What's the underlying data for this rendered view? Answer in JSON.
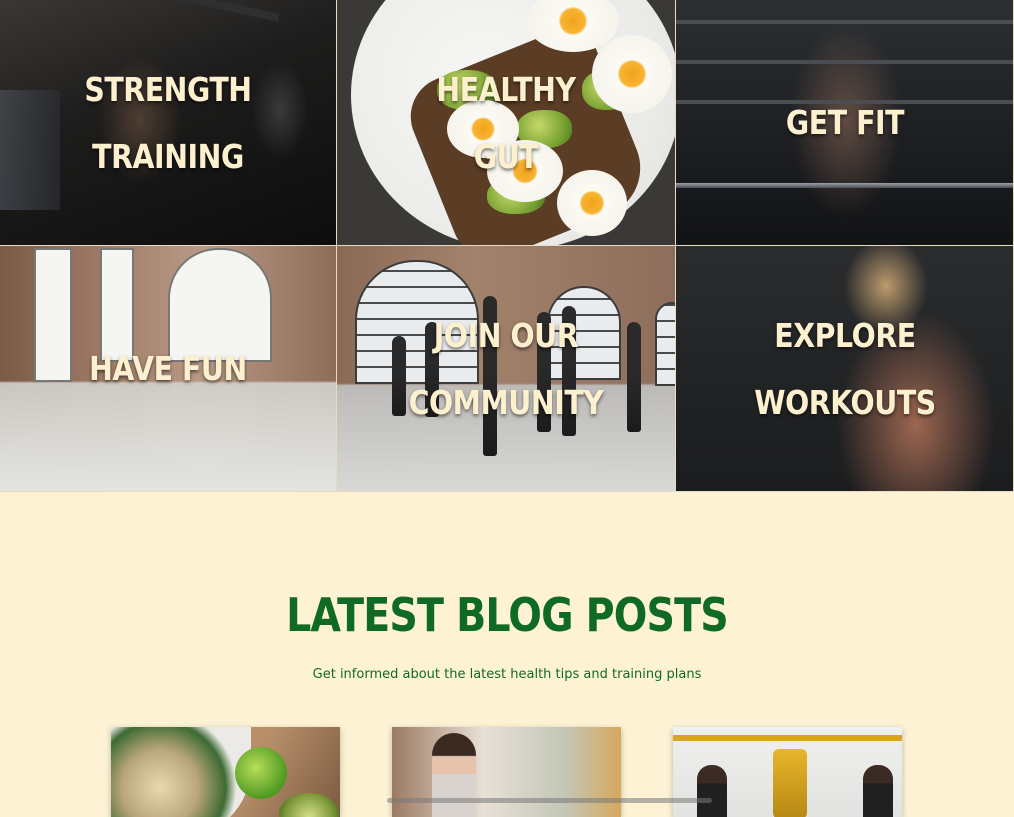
{
  "tiles": [
    {
      "label": "STRENGTH TRAINING",
      "image": "strength-training-photo"
    },
    {
      "label": "HEALTHY GUT",
      "image": "healthy-gut-photo"
    },
    {
      "label": "GET FIT",
      "image": "get-fit-photo"
    },
    {
      "label": "HAVE FUN",
      "image": "have-fun-photo"
    },
    {
      "label": "JOIN OUR COMMUNITY",
      "image": "join-our-community-photo"
    },
    {
      "label": "EXPLORE WORKOUTS",
      "image": "explore-workouts-photo"
    }
  ],
  "blog": {
    "title": "LATEST BLOG POSTS",
    "subtitle": "Get informed about the latest health tips and training plans",
    "cards": [
      {
        "image": "healthy-bowl-photo"
      },
      {
        "image": "runner-photo"
      },
      {
        "image": "boxing-photo"
      }
    ]
  },
  "colors": {
    "page_background": "#fdf2d4",
    "accent_green": "#0f6b24",
    "tile_text": "#fdf0cf"
  }
}
